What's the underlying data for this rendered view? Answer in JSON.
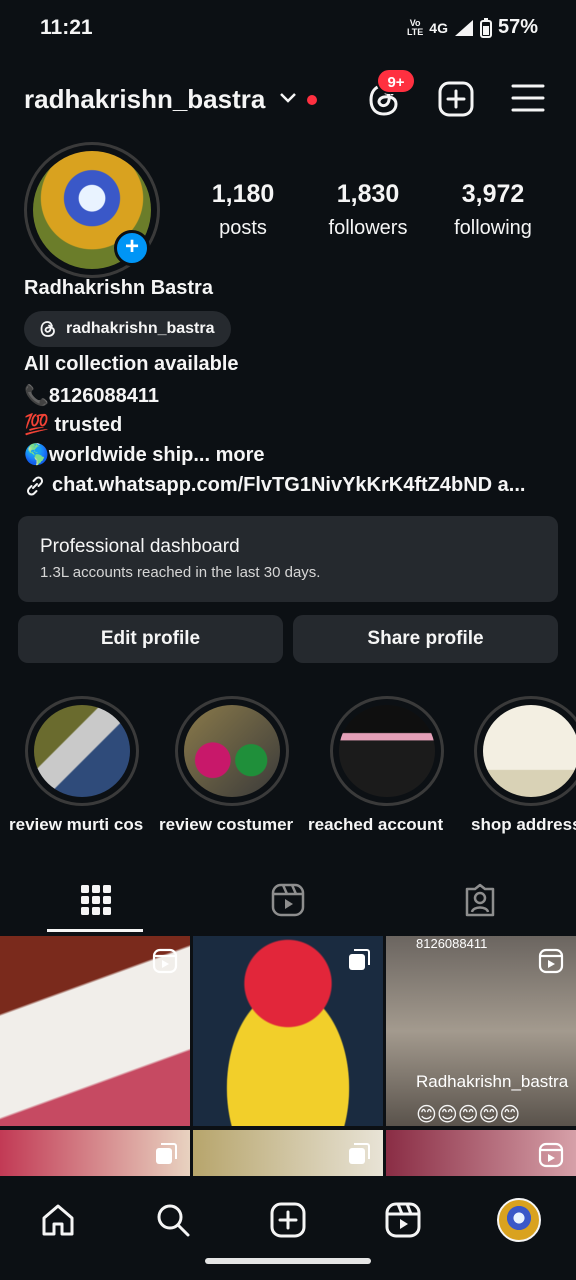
{
  "status_bar": {
    "time": "11:21",
    "volte": "Vo\nLTE",
    "network": "4G",
    "battery": "57%"
  },
  "header": {
    "username": "radhakrishn_bastra",
    "notifications_badge": "9+"
  },
  "profile": {
    "stats": [
      {
        "value": "1,180",
        "label": "posts"
      },
      {
        "value": "1,830",
        "label": "followers"
      },
      {
        "value": "3,972",
        "label": "following"
      }
    ],
    "display_name": "Radhakrishn Bastra",
    "threads_handle": "radhakrishn_bastra",
    "bio_lines": [
      "All collection available",
      "📞8126088411",
      "💯 trusted",
      "🌎worldwide ship..."
    ],
    "bio_more": "more",
    "link": "chat.whatsapp.com/FlvTG1NivYkKrK4ftZ4bND a..."
  },
  "dashboard": {
    "title": "Professional dashboard",
    "subtitle": "1.3L accounts reached in the last 30 days."
  },
  "buttons": {
    "edit_profile": "Edit profile",
    "share_profile": "Share profile"
  },
  "highlights": [
    {
      "label": "review murti cos"
    },
    {
      "label": "review costumer"
    },
    {
      "label": "reached account"
    },
    {
      "label": "shop address"
    }
  ],
  "grid": {
    "tile3_watermark": "8126088411",
    "tile3_caption": "Radhakrishn_bastra",
    "tile3_emojis": "😊😊😊😊😊"
  },
  "colors": {
    "background": "#0c1014",
    "accent_blue": "#0095f6",
    "badge_red": "#ff3040",
    "card": "#25292e"
  }
}
